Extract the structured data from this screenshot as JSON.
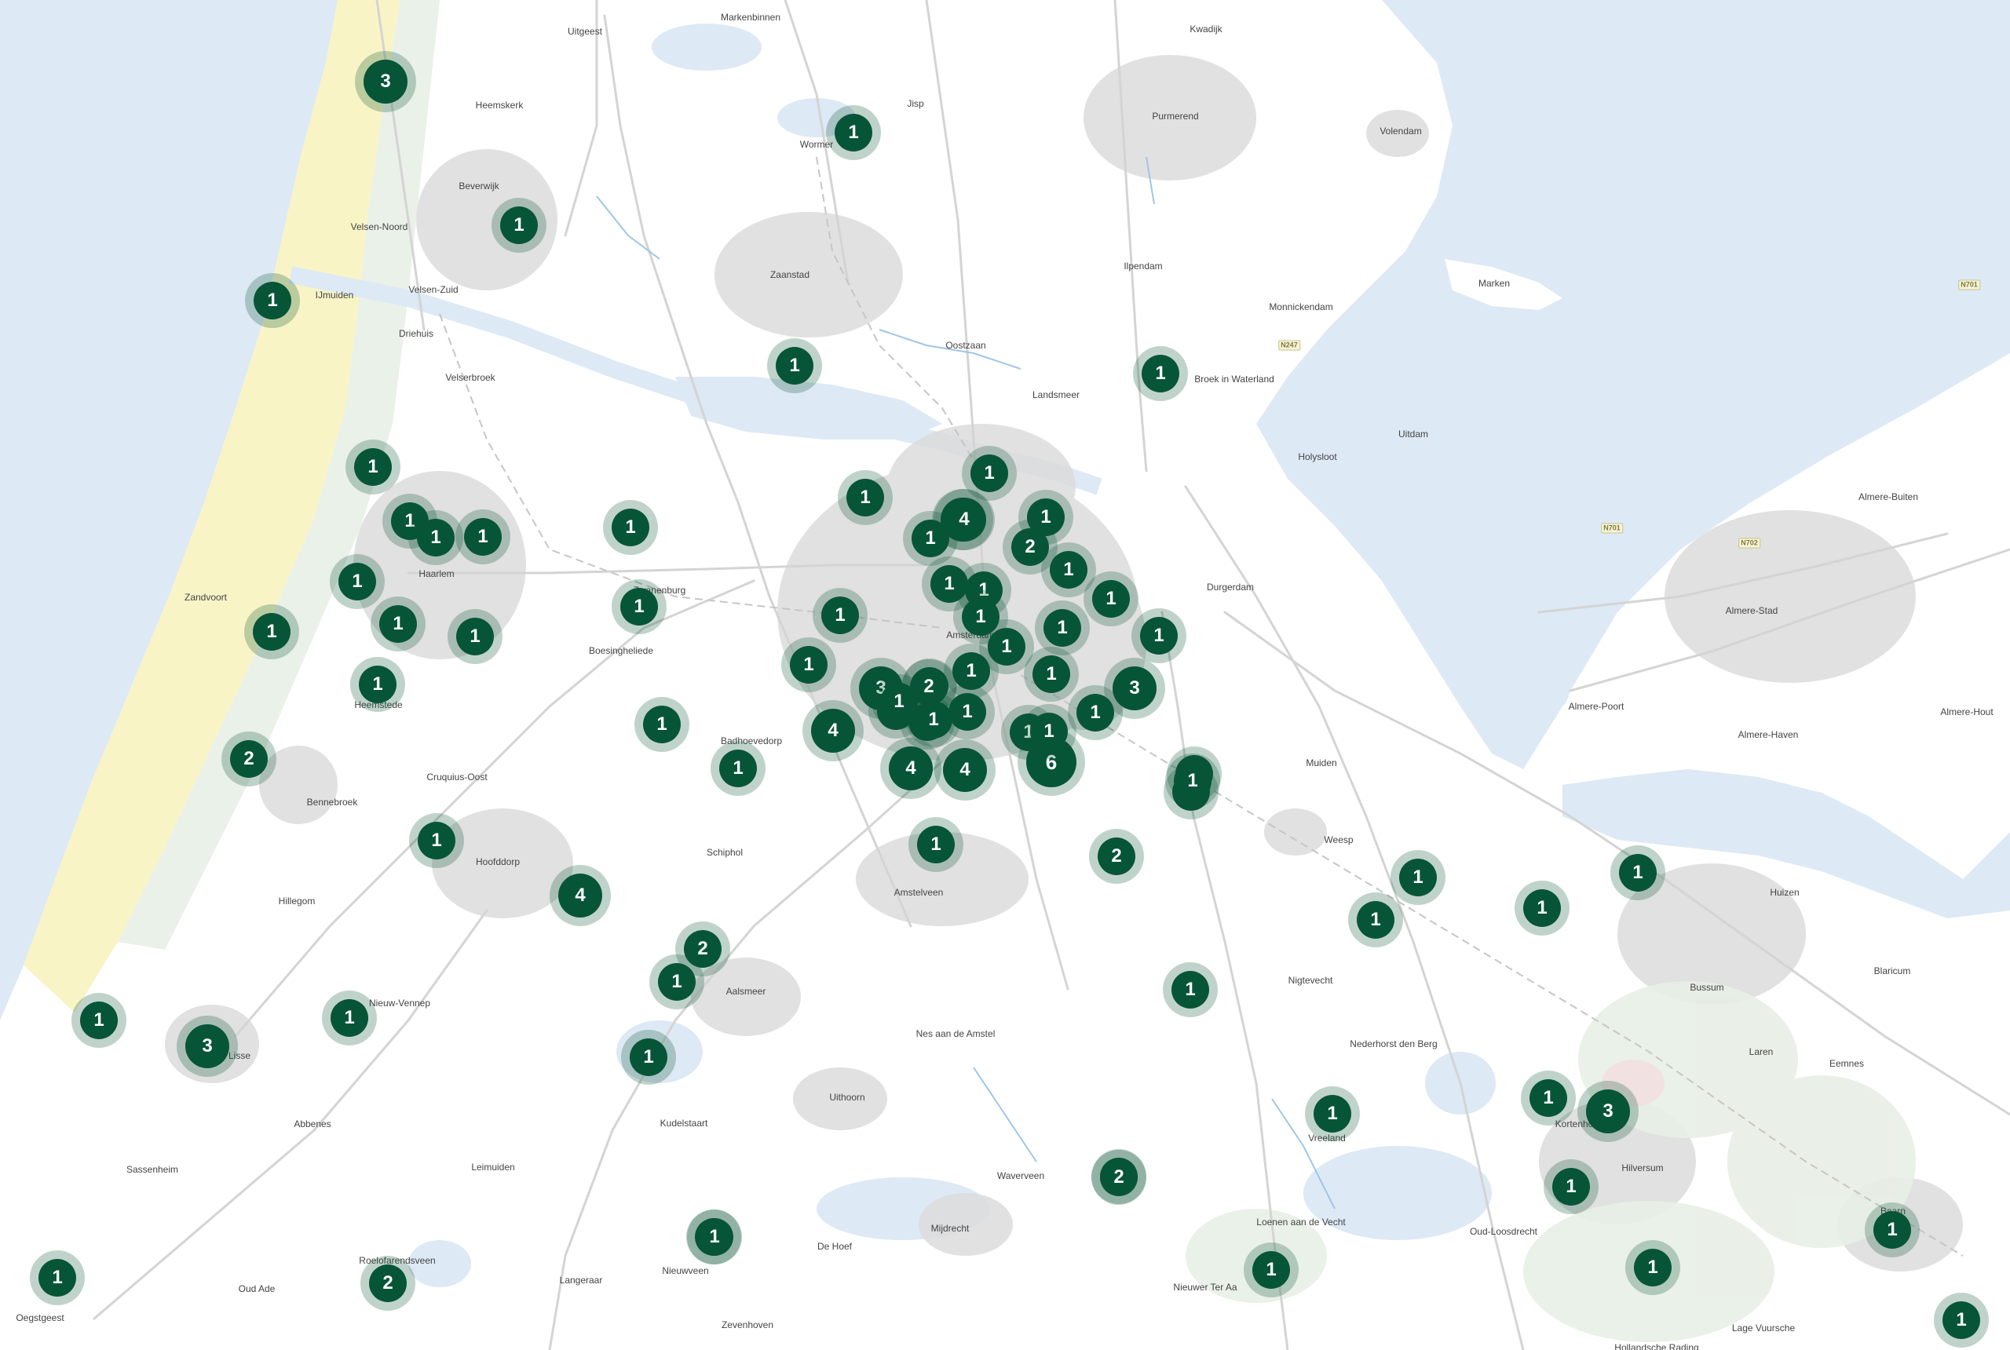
{
  "map": {
    "colors": {
      "water": "#dde9f5",
      "land": "#ffffff",
      "urban": "#dcdcdc",
      "beach": "#f8f3c0",
      "nature": "#e8efe5",
      "road": "#d4d4d4",
      "canal": "#9fc6e6",
      "cluster_core": "#065537",
      "cluster_halo": "rgba(10,85,55,0.26)",
      "cluster_text": "#ffffff"
    },
    "places": [
      {
        "id": "uitgeest",
        "name": "Uitgeest"
      },
      {
        "id": "markenbinnen",
        "name": "Markenbinnen"
      },
      {
        "id": "kwadijk",
        "name": "Kwadijk"
      },
      {
        "id": "heemskerk",
        "name": "Heemskerk"
      },
      {
        "id": "jisp",
        "name": "Jisp"
      },
      {
        "id": "wormer",
        "name": "Wormer"
      },
      {
        "id": "purmerend",
        "name": "Purmerend"
      },
      {
        "id": "volendam",
        "name": "Volendam"
      },
      {
        "id": "beverwijk",
        "name": "Beverwijk"
      },
      {
        "id": "velsen-noord",
        "name": "Velsen-Noord"
      },
      {
        "id": "zaanstad",
        "name": "Zaanstad"
      },
      {
        "id": "ilpendam",
        "name": "Ilpendam"
      },
      {
        "id": "marken",
        "name": "Marken"
      },
      {
        "id": "ijmuiden",
        "name": "IJmuiden"
      },
      {
        "id": "velsen-zuid",
        "name": "Velsen-Zuid"
      },
      {
        "id": "monnickendam",
        "name": "Monnickendam"
      },
      {
        "id": "driehuis",
        "name": "Driehuis"
      },
      {
        "id": "oostzaan",
        "name": "Oostzaan"
      },
      {
        "id": "velserbroek",
        "name": "Velserbroek"
      },
      {
        "id": "broek-in-waterland",
        "name": "Broek in Waterland"
      },
      {
        "id": "landsmeer",
        "name": "Landsmeer"
      },
      {
        "id": "uitdam",
        "name": "Uitdam"
      },
      {
        "id": "holysloot",
        "name": "Holysloot"
      },
      {
        "id": "almere-buiten",
        "name": "Almere-Buiten"
      },
      {
        "id": "haarlem",
        "name": "Haarlem"
      },
      {
        "id": "durgerdam",
        "name": "Durgerdam"
      },
      {
        "id": "zandvoort",
        "name": "Zandvoort"
      },
      {
        "id": "halfweg",
        "name": "Zwanenburg"
      },
      {
        "id": "almere-stad",
        "name": "Almere-Stad"
      },
      {
        "id": "amsterdam",
        "name": "Amsterdam"
      },
      {
        "id": "boesingheliede",
        "name": "Boesingheliede"
      },
      {
        "id": "heemstede",
        "name": "Heemstede"
      },
      {
        "id": "almere-poort",
        "name": "Almere-Poort"
      },
      {
        "id": "almere-hout",
        "name": "Almere-Hout"
      },
      {
        "id": "badhoevedorp",
        "name": "Badhoevedorp"
      },
      {
        "id": "almere-haven",
        "name": "Almere-Haven"
      },
      {
        "id": "cruquius-oost",
        "name": "Cruquius-Oost"
      },
      {
        "id": "muiden",
        "name": "Muiden"
      },
      {
        "id": "bennebroek",
        "name": "Bennebroek"
      },
      {
        "id": "schiphol",
        "name": "Schiphol"
      },
      {
        "id": "weesp",
        "name": "Weesp"
      },
      {
        "id": "hoofddorp",
        "name": "Hoofddorp"
      },
      {
        "id": "amstelveen",
        "name": "Amstelveen"
      },
      {
        "id": "huizen",
        "name": "Huizen"
      },
      {
        "id": "hillegom",
        "name": "Hillegom"
      },
      {
        "id": "blaricum",
        "name": "Blaricum"
      },
      {
        "id": "nigtevecht",
        "name": "Nigtevecht"
      },
      {
        "id": "aalsmeer",
        "name": "Aalsmeer"
      },
      {
        "id": "bussum",
        "name": "Bussum"
      },
      {
        "id": "nieuw-vennep",
        "name": "Nieuw-Vennep"
      },
      {
        "id": "nes-aan-de-amstel",
        "name": "Nes aan de Amstel"
      },
      {
        "id": "nederhorst-den-berg",
        "name": "Nederhorst den Berg"
      },
      {
        "id": "laren",
        "name": "Laren"
      },
      {
        "id": "lisse",
        "name": "Lisse"
      },
      {
        "id": "eemnes",
        "name": "Eemnes"
      },
      {
        "id": "uithoorn",
        "name": "Uithoorn"
      },
      {
        "id": "abbenes",
        "name": "Abbenes"
      },
      {
        "id": "kudelstaart",
        "name": "Kudelstaart"
      },
      {
        "id": "vreeland",
        "name": "Vreeland"
      },
      {
        "id": "kortenhoef",
        "name": "Kortenhoef"
      },
      {
        "id": "sassenheim",
        "name": "Sassenheim"
      },
      {
        "id": "leimuiden",
        "name": "Leimuiden"
      },
      {
        "id": "hilversum",
        "name": "Hilversum"
      },
      {
        "id": "waverveen",
        "name": "Waverveen"
      },
      {
        "id": "loenen",
        "name": "Loenen aan de Vecht"
      },
      {
        "id": "oud-loosdrecht",
        "name": "Oud-Loosdrecht"
      },
      {
        "id": "mijdrecht",
        "name": "Mijdrecht"
      },
      {
        "id": "de-hoef",
        "name": "De Hoef"
      },
      {
        "id": "baarn",
        "name": "Baarn"
      },
      {
        "id": "roelofarendsveen",
        "name": "Roelofarendsveen"
      },
      {
        "id": "nieuwveen",
        "name": "Nieuwveen"
      },
      {
        "id": "langeraar",
        "name": "Langeraar"
      },
      {
        "id": "oud-ade",
        "name": "Oud Ade"
      },
      {
        "id": "nieuwer-ter-aa",
        "name": "Nieuwer Ter Aa"
      },
      {
        "id": "oegstgeest",
        "name": "Oegstgeest"
      },
      {
        "id": "zevenhoven",
        "name": "Zevenhoven"
      },
      {
        "id": "lage-vuursche",
        "name": "Lage Vuursche"
      },
      {
        "id": "hollandsche-rading",
        "name": "Hollandsche Rading"
      }
    ],
    "road_shields": [
      {
        "id": "n701-a",
        "label": "N701"
      },
      {
        "id": "n247",
        "label": "N247"
      },
      {
        "id": "n701-b",
        "label": "N701"
      },
      {
        "id": "n702",
        "label": "N702"
      }
    ],
    "clusters": [
      {
        "id": "c01",
        "count": 3
      },
      {
        "id": "c02",
        "count": 1
      },
      {
        "id": "c03",
        "count": 1
      },
      {
        "id": "c04",
        "count": 1
      },
      {
        "id": "c05",
        "count": 1
      },
      {
        "id": "c06",
        "count": 1
      },
      {
        "id": "c07",
        "count": 1
      },
      {
        "id": "c08",
        "count": 1
      },
      {
        "id": "c09",
        "count": 1
      },
      {
        "id": "c10",
        "count": 1
      },
      {
        "id": "c11",
        "count": 1
      },
      {
        "id": "c12",
        "count": 1
      },
      {
        "id": "c13",
        "count": 1
      },
      {
        "id": "c14",
        "count": 1
      },
      {
        "id": "c15",
        "count": 1
      },
      {
        "id": "c16",
        "count": 1
      },
      {
        "id": "c17",
        "count": 1
      },
      {
        "id": "c18",
        "count": 1
      },
      {
        "id": "c19",
        "count": 1
      },
      {
        "id": "c20",
        "count": 2
      },
      {
        "id": "c21",
        "count": 1
      },
      {
        "id": "c22",
        "count": 4
      },
      {
        "id": "c23",
        "count": 1
      },
      {
        "id": "c24",
        "count": 1
      },
      {
        "id": "c25",
        "count": 1
      },
      {
        "id": "c26",
        "count": 4
      },
      {
        "id": "c27",
        "count": 1
      },
      {
        "id": "c28",
        "count": 1
      },
      {
        "id": "c29",
        "count": 1
      },
      {
        "id": "c30",
        "count": 1
      },
      {
        "id": "c31",
        "count": 1
      },
      {
        "id": "c32",
        "count": 1
      },
      {
        "id": "c33",
        "count": 1
      },
      {
        "id": "c34",
        "count": 2
      },
      {
        "id": "c35",
        "count": 1
      },
      {
        "id": "c36",
        "count": 1
      },
      {
        "id": "c37",
        "count": 1
      },
      {
        "id": "c38",
        "count": 1
      },
      {
        "id": "c39",
        "count": 3
      },
      {
        "id": "c40",
        "count": 2
      },
      {
        "id": "c41",
        "count": 1
      },
      {
        "id": "c42",
        "count": 1
      },
      {
        "id": "c43",
        "count": 1
      },
      {
        "id": "c44",
        "count": 1
      },
      {
        "id": "c45",
        "count": 1
      },
      {
        "id": "c46",
        "count": 3
      },
      {
        "id": "c47",
        "count": 1
      },
      {
        "id": "c48",
        "count": 1
      },
      {
        "id": "c49",
        "count": 4
      },
      {
        "id": "c50",
        "count": 1
      },
      {
        "id": "c51",
        "count": 4
      },
      {
        "id": "c52",
        "count": 4
      },
      {
        "id": "c53",
        "count": 1
      },
      {
        "id": "c54",
        "count": 6
      },
      {
        "id": "c55",
        "count": 1
      },
      {
        "id": "c56",
        "count": 1
      },
      {
        "id": "c57",
        "count": 2
      },
      {
        "id": "c58",
        "count": 1
      },
      {
        "id": "c59",
        "count": 1
      },
      {
        "id": "c60",
        "count": 2
      },
      {
        "id": "c61",
        "count": 1
      },
      {
        "id": "c62",
        "count": 4
      },
      {
        "id": "c63",
        "count": 1
      },
      {
        "id": "c64",
        "count": 1
      },
      {
        "id": "c65",
        "count": 1
      },
      {
        "id": "c66",
        "count": 1
      },
      {
        "id": "c67",
        "count": 1
      },
      {
        "id": "c68",
        "count": 2
      },
      {
        "id": "c69",
        "count": 1
      },
      {
        "id": "c70",
        "count": 1
      },
      {
        "id": "c71",
        "count": 1
      },
      {
        "id": "c72",
        "count": 3
      },
      {
        "id": "c73",
        "count": 1
      },
      {
        "id": "c74",
        "count": 1
      },
      {
        "id": "c75",
        "count": 2
      },
      {
        "id": "c76",
        "count": 1
      },
      {
        "id": "c77",
        "count": 1
      },
      {
        "id": "c78",
        "count": 1
      },
      {
        "id": "c79",
        "count": 1
      },
      {
        "id": "c80",
        "count": 3
      },
      {
        "id": "c81",
        "count": 1
      },
      {
        "id": "c82",
        "count": 1
      },
      {
        "id": "c83",
        "count": 1
      },
      {
        "id": "c84",
        "count": 2
      },
      {
        "id": "c85",
        "count": 1
      },
      {
        "id": "c86",
        "count": 1
      },
      {
        "id": "c87",
        "count": 1
      }
    ]
  }
}
